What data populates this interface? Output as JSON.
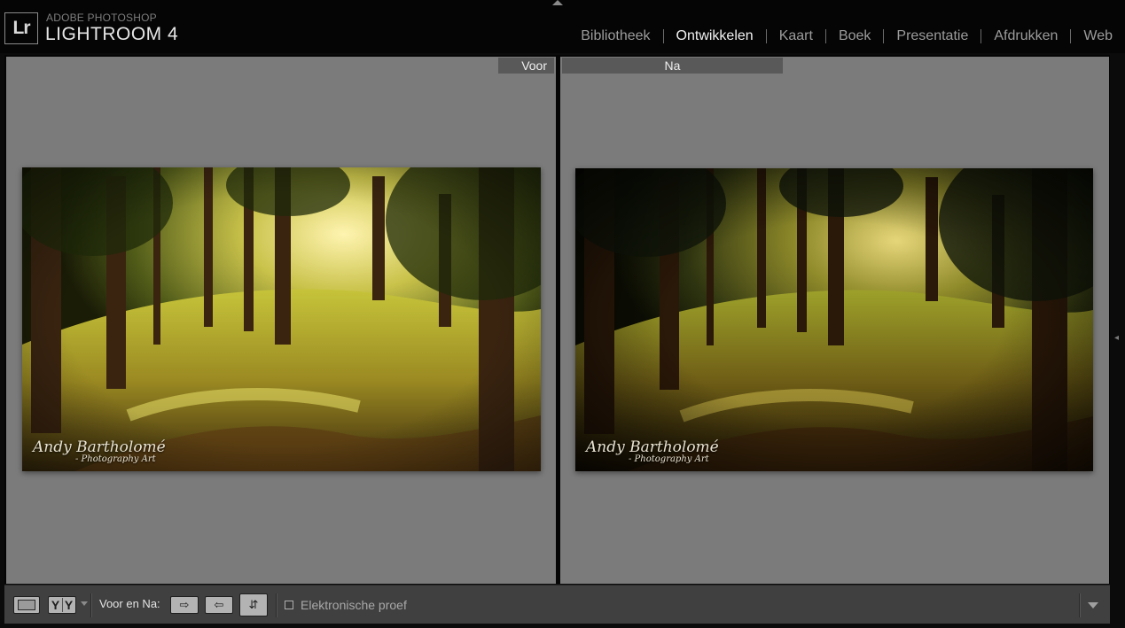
{
  "app": {
    "logo": "Lr",
    "brand_top": "ADOBE PHOTOSHOP",
    "brand_main": "LIGHTROOM 4"
  },
  "modules": [
    {
      "label": "Bibliotheek",
      "active": false
    },
    {
      "label": "Ontwikkelen",
      "active": true
    },
    {
      "label": "Kaart",
      "active": false
    },
    {
      "label": "Boek",
      "active": false
    },
    {
      "label": "Presentatie",
      "active": false
    },
    {
      "label": "Afdrukken",
      "active": false
    },
    {
      "label": "Web",
      "active": false
    }
  ],
  "panes": {
    "before_label": "Voor",
    "after_label": "Na"
  },
  "watermark": {
    "name": "Andy Bartholomé",
    "sub": "- Photography Art"
  },
  "toolbar": {
    "view_mode": "YY",
    "before_after_label": "Voor en Na:",
    "soft_proof_label": "Elektronische proef",
    "soft_proof_checked": false
  },
  "colors": {
    "pane_background": "#7b7b7b",
    "label_background": "#595959",
    "toolbar_background": "#404040"
  }
}
